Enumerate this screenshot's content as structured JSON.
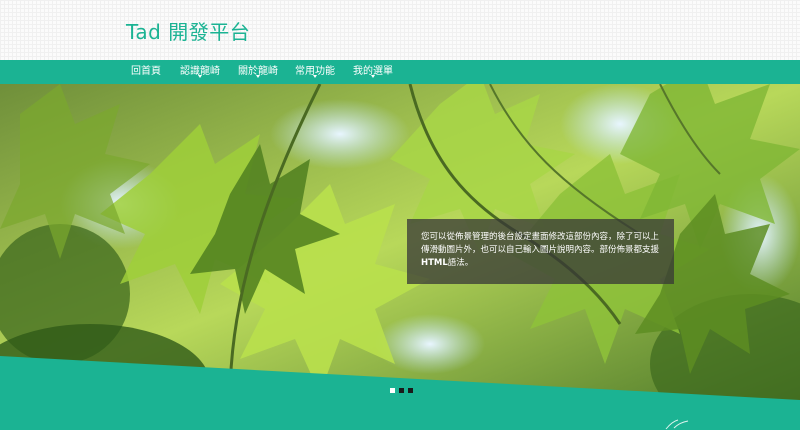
{
  "site": {
    "title": "Tad 開發平台"
  },
  "nav": {
    "items": [
      {
        "label": "回首頁"
      },
      {
        "label": "認識龍崎"
      },
      {
        "label": "關於龍崎"
      },
      {
        "label": "常用功能"
      },
      {
        "label": "我的選單"
      }
    ]
  },
  "slider": {
    "caption_text": "您可以從佈景管理的後台設定畫面修改這部份內容，除了可以上傳滑動圖片外，也可以自己輸入圖片說明內容。部份佈景都支援",
    "caption_bold": "HTML",
    "caption_suffix": "語法。",
    "dots": [
      {
        "active": true
      },
      {
        "active": false
      },
      {
        "active": false
      }
    ]
  },
  "colors": {
    "accent": "#1bb393",
    "caption_bg": "#373737"
  }
}
